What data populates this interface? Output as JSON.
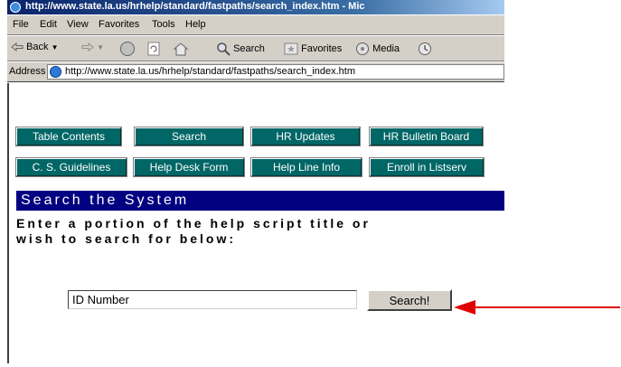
{
  "window": {
    "title": "http://www.state.la.us/hrhelp/standard/fastpaths/search_index.htm - Mic"
  },
  "menu": [
    "File",
    "Edit",
    "View",
    "Favorites",
    "Tools",
    "Help"
  ],
  "toolbar": {
    "back": "Back",
    "search": "Search",
    "favorites": "Favorites",
    "media": "Media"
  },
  "address": {
    "label": "Address",
    "url": "http://www.state.la.us/hrhelp/standard/fastpaths/search_index.htm"
  },
  "nav": {
    "row1": [
      "Table Contents",
      "Search",
      "HR Updates",
      "HR Bulletin Board"
    ],
    "row2": [
      "C. S. Guidelines",
      "Help Desk Form",
      "Help Line Info",
      "Enroll in Listserv"
    ]
  },
  "page": {
    "heading": "Search the System",
    "instructions_line1": "Enter a portion of the help script title or",
    "instructions_line2": "wish to search for below:",
    "search_value": "ID Number",
    "search_button": "Search!"
  },
  "colors": {
    "nav_button_bg": "#006666",
    "heading_bg": "#000080",
    "arrow": "#e00000"
  }
}
